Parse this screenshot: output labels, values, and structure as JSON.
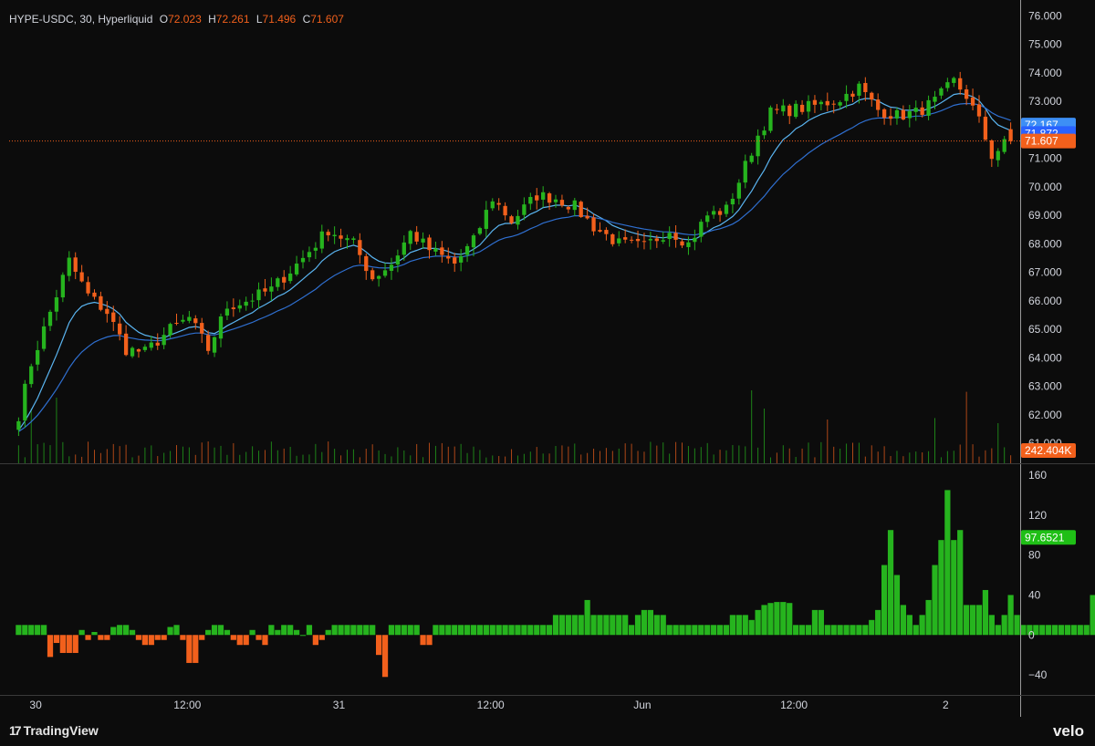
{
  "header": {
    "symbol_text": "HYPE-USDC, 30, Hyperliquid",
    "open_key": "O",
    "open_val": "72.023",
    "high_key": "H",
    "high_val": "72.261",
    "low_key": "L",
    "low_val": "71.496",
    "close_key": "C",
    "close_val": "71.607"
  },
  "footer": {
    "logo_mark": "17",
    "logo_text": "TradingView",
    "brand": "velo"
  },
  "colors": {
    "background": "#0c0c0c",
    "up": "#26b41e",
    "down": "#f2601c",
    "ma_fast": "#5ab4f0",
    "ma_slow": "#2f6fd0",
    "tag_blue_light": "#3d8ff5",
    "tag_blue_dark": "#2962ff",
    "tag_orange": "#f2601c",
    "tag_green": "#1fbf16"
  },
  "chart_data": [
    {
      "type": "candlestick",
      "ylim": [
        60.3,
        76.3
      ],
      "y_ticks": [
        "76.000",
        "75.000",
        "74.000",
        "73.000",
        "72.000",
        "71.000",
        "70.000",
        "69.000",
        "68.000",
        "67.000",
        "66.000",
        "65.000",
        "64.000",
        "63.000",
        "62.000",
        "61.000"
      ],
      "x_ticks": [
        "30",
        "12:00",
        "31",
        "12:00",
        "Jun",
        "12:00",
        "2"
      ],
      "x_tick_times": [
        2.7,
        26.7,
        50.7,
        74.7,
        98.7,
        122.7,
        146.7
      ],
      "x_range": [
        -1.5,
        158.5
      ],
      "key_points": [
        [
          0,
          62.0
        ],
        [
          2,
          63.8
        ],
        [
          5,
          65.6
        ],
        [
          8,
          67.4
        ],
        [
          11,
          66.2
        ],
        [
          14,
          65.6
        ],
        [
          17,
          64.3
        ],
        [
          20,
          64.2
        ],
        [
          24,
          65.0
        ],
        [
          27,
          65.4
        ],
        [
          30,
          64.3
        ],
        [
          33,
          65.8
        ],
        [
          36,
          66.0
        ],
        [
          40,
          66.4
        ],
        [
          45,
          67.5
        ],
        [
          49,
          68.5
        ],
        [
          53,
          68.0
        ],
        [
          56,
          66.8
        ],
        [
          59,
          67.3
        ],
        [
          62,
          68.4
        ],
        [
          65,
          67.8
        ],
        [
          69,
          67.3
        ],
        [
          72,
          68.1
        ],
        [
          75,
          69.6
        ],
        [
          78,
          68.8
        ],
        [
          82,
          69.7
        ],
        [
          85,
          69.6
        ],
        [
          88,
          69.3
        ],
        [
          91,
          68.6
        ],
        [
          95,
          68.0
        ],
        [
          99,
          67.9
        ],
        [
          103,
          68.5
        ],
        [
          106,
          68.0
        ],
        [
          109,
          69.0
        ],
        [
          112,
          69.2
        ],
        [
          114,
          70.2
        ],
        [
          117,
          71.8
        ],
        [
          119,
          72.6
        ],
        [
          122,
          72.7
        ],
        [
          125,
          72.8
        ],
        [
          127,
          72.9
        ],
        [
          130,
          73.1
        ],
        [
          133,
          73.5
        ],
        [
          136,
          72.7
        ],
        [
          139,
          72.5
        ],
        [
          142,
          72.6
        ],
        [
          145,
          73.0
        ],
        [
          148,
          73.7
        ],
        [
          150,
          73.2
        ],
        [
          152,
          72.3
        ],
        [
          154,
          71.1
        ],
        [
          156,
          71.5
        ],
        [
          157,
          71.607
        ]
      ],
      "legend": [
        {
          "label": "72.167",
          "value": 72.167,
          "color_key": "tag_blue_light"
        },
        {
          "label": "71.872",
          "value": 71.872,
          "color_key": "tag_blue_dark"
        },
        {
          "label": "71.607",
          "value": 71.607,
          "color_key": "tag_orange"
        }
      ],
      "price_line": 71.607
    },
    {
      "type": "bar",
      "name": "volume",
      "last_label": "242.404K",
      "spikes": [
        [
          116,
          1.0
        ],
        [
          150,
          0.98
        ],
        [
          145,
          0.62
        ],
        [
          118,
          0.75
        ],
        [
          128,
          0.6
        ],
        [
          2,
          0.75
        ],
        [
          6,
          0.9
        ],
        [
          155,
          0.55
        ]
      ]
    },
    {
      "type": "bar",
      "name": "oscillator",
      "ylim": [
        -60,
        170
      ],
      "y_ticks": [
        "160",
        "120",
        "80",
        "40",
        "0",
        "−40"
      ],
      "y_tick_values": [
        160,
        120,
        80,
        40,
        0,
        -40
      ],
      "last_label": "97.6521",
      "values": [
        10,
        10,
        10,
        10,
        10,
        -22,
        -8,
        -18,
        -18,
        -18,
        5,
        -5,
        3,
        -5,
        -5,
        8,
        10,
        10,
        5,
        -5,
        -10,
        -10,
        -5,
        -5,
        8,
        10,
        -5,
        -28,
        -28,
        -5,
        5,
        10,
        10,
        5,
        -5,
        -10,
        -10,
        5,
        -5,
        -10,
        10,
        5,
        10,
        10,
        5,
        0,
        10,
        -10,
        -5,
        5,
        10,
        10,
        10,
        10,
        10,
        10,
        10,
        -20,
        -42,
        10,
        10,
        10,
        10,
        10,
        -10,
        -10,
        10,
        10,
        10,
        10,
        10,
        10,
        10,
        10,
        10,
        10,
        10,
        10,
        10,
        10,
        10,
        10,
        10,
        10,
        10,
        20,
        20,
        20,
        20,
        20,
        35,
        20,
        20,
        20,
        20,
        20,
        20,
        10,
        20,
        25,
        25,
        20,
        20,
        10,
        10,
        10,
        10,
        10,
        10,
        10,
        10,
        10,
        10,
        20,
        20,
        20,
        15,
        25,
        30,
        32,
        33,
        33,
        32,
        10,
        10,
        10,
        25,
        25,
        10,
        10,
        10,
        10,
        10,
        10,
        10,
        15,
        25,
        70,
        105,
        60,
        30,
        20,
        10,
        20,
        35,
        70,
        95,
        145,
        95,
        105,
        30,
        30,
        30,
        45,
        20,
        10,
        20,
        40,
        20,
        10,
        10,
        10,
        10,
        10,
        10,
        10,
        10,
        10,
        10,
        10,
        40,
        58,
        10,
        100,
        97.6521
      ]
    }
  ]
}
